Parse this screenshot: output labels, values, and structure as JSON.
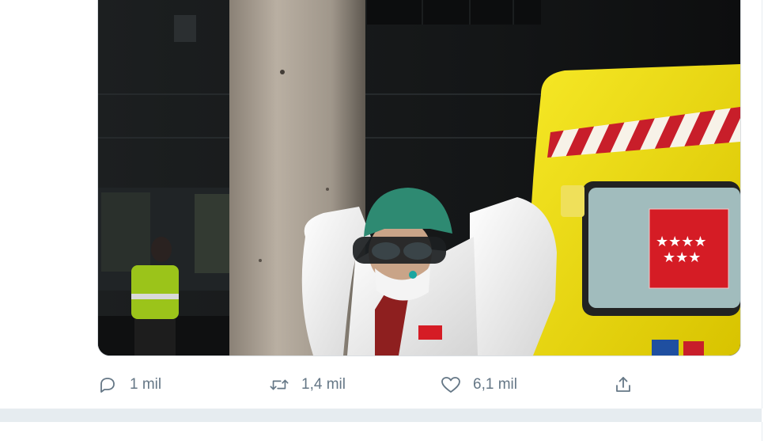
{
  "tweet": {
    "media": {
      "alt_icons": [
        "ambulance",
        "health-worker"
      ],
      "colors": {
        "ambulance_yellow": "#f3e10e",
        "stripe_red": "#c81e2a",
        "madrid_flag_red": "#d51c25",
        "suit_white": "#eeeeee",
        "cap_green": "#2e8a72"
      }
    },
    "actions": {
      "reply": {
        "icon": "reply-icon",
        "count": "1 mil"
      },
      "retweet": {
        "icon": "retweet-icon",
        "count": "1,4 mil"
      },
      "like": {
        "icon": "heart-icon",
        "count": "6,1 mil"
      },
      "share": {
        "icon": "share-icon",
        "count": ""
      }
    }
  },
  "theme": {
    "muted": "#657786",
    "divider": "#e6ecf0"
  }
}
